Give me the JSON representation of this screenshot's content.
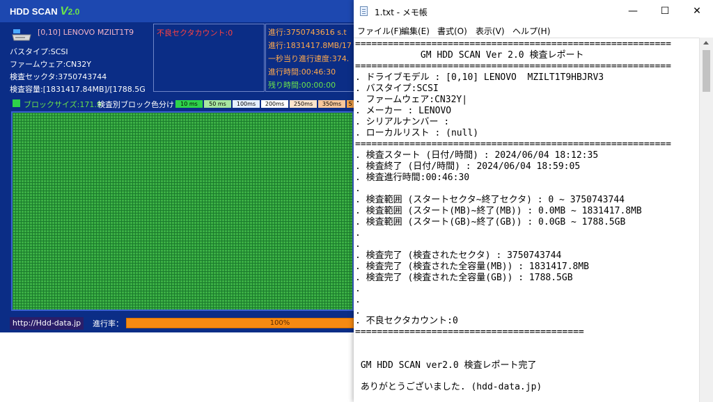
{
  "hdd": {
    "logo_text": "HDD SCAN",
    "version_letter": "V",
    "version_number": "2.0",
    "drive_model": "[0,10] LENOVO  MZILT1T9",
    "bus_type": "バスタイプ:SCSI",
    "firmware": "ファームウェア:CN32Y",
    "sectors": "検査セックタ:3750743744",
    "capacity": "検査容量:[1831417.84MB]/[1788.5G",
    "bad_sector": "不良セクタカウント:0",
    "progress_lines": [
      "進行:3750743616 s.t",
      "進行:1831417.8MB/17",
      "一秒当り進行速度:374.",
      "進行時間:00:46:30",
      "残り時間:00:00:00"
    ],
    "block_size": "ブロックサイズ:171.9",
    "color_legend_label": "検査別ブロック色分け：",
    "buckets": [
      "10 ms",
      "50 ms",
      "100ms",
      "200ms",
      "250ms",
      "350ms",
      "5"
    ],
    "website": "http://Hdd-data.jp",
    "progress_label": "進行率：",
    "progress_percent": "100%",
    "progress_value": 1.0,
    "colors": {
      "background": "#0b2d86",
      "titlebar": "#1d48b0",
      "grid": "#3cb045",
      "progress": "#f68a12"
    }
  },
  "notepad": {
    "title": "1.txt - メモ帳",
    "window_buttons": [
      "—",
      "☐",
      "✕"
    ],
    "menu": [
      "ファイル(F)",
      "編集(E)",
      "書式(O)",
      "表示(V)",
      "ヘルプ(H)"
    ],
    "lines": [
      "==========================================================",
      "            GM HDD SCAN Ver 2.0 検査レポート",
      "==========================================================",
      ". ドライブモデル : [0,10] LENOVO  MZILT1T9HBJRV3",
      ". バスタイプ:SCSI",
      ". ファームウェア:CN32Y|",
      ". メーカー : LENOVO",
      ". シリアルナンバー :",
      ". ローカルリスト : (null)",
      "==========================================================",
      ". 検査スタート (日付/時間) : 2024/06/04 18:12:35",
      ". 検査終了 (日付/時間) : 2024/06/04 18:59:05",
      ". 検査進行時間:00:46:30",
      ".",
      ". 検査範囲 (スタートセクタ~終了セクタ) : 0 ~ 3750743744",
      ". 検査範囲 (スタート(MB)~終了(MB)) : 0.0MB ~ 1831417.8MB",
      ". 検査範囲 (スタート(GB)~終了(GB)) : 0.0GB ~ 1788.5GB",
      ".",
      ".",
      ". 検査完了 (検査されたセクタ) : 3750743744",
      ". 検査完了 (検査された全容量(MB)) : 1831417.8MB",
      ". 検査完了 (検査された全容量(GB)) : 1788.5GB",
      ".",
      ".",
      ".",
      ". 不良セクタカウント:0",
      "==========================================",
      "",
      "",
      " GM HDD SCAN ver2.0 検査レポート完了",
      "",
      " ありがとうございました. (hdd-data.jp)"
    ]
  }
}
